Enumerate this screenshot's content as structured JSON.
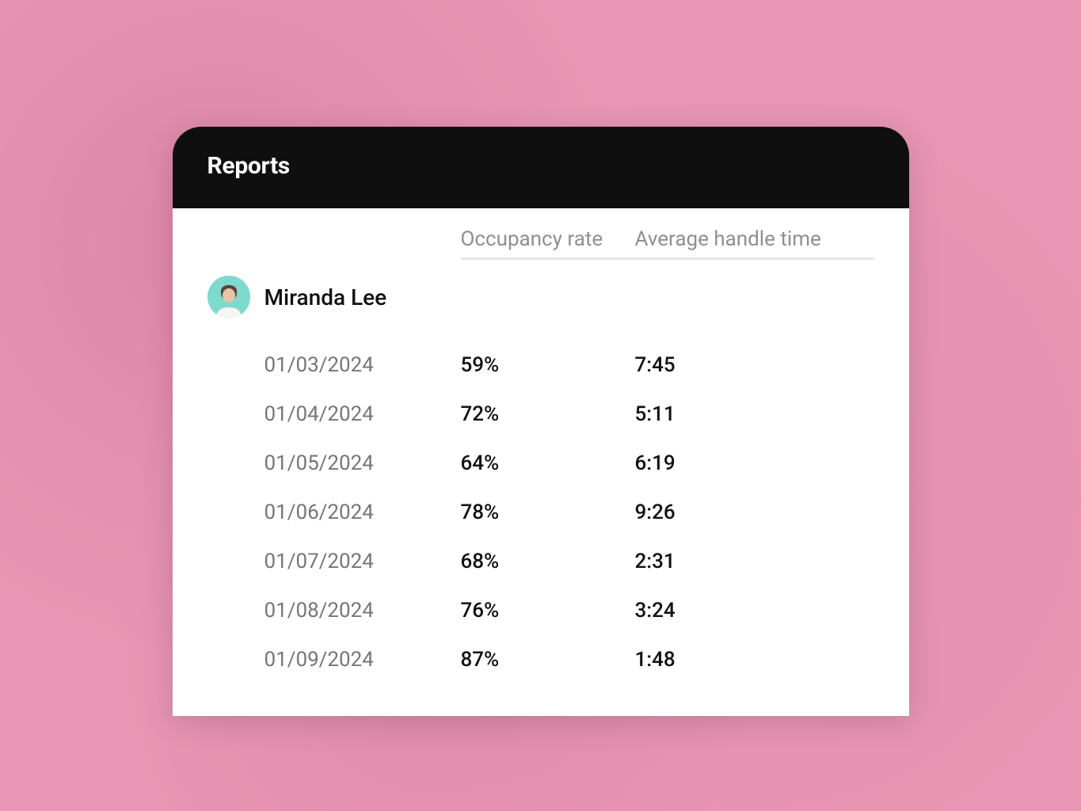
{
  "card": {
    "title": "Reports"
  },
  "columns": {
    "occupancy": "Occupancy rate",
    "handle_time": "Average handle time"
  },
  "agent": {
    "name": "Miranda Lee",
    "avatar_bg": "#7ed9cf"
  },
  "rows": [
    {
      "date": "01/03/2024",
      "occupancy": "59%",
      "handle_time": "7:45"
    },
    {
      "date": "01/04/2024",
      "occupancy": "72%",
      "handle_time": "5:11"
    },
    {
      "date": "01/05/2024",
      "occupancy": "64%",
      "handle_time": "6:19"
    },
    {
      "date": "01/06/2024",
      "occupancy": "78%",
      "handle_time": "9:26"
    },
    {
      "date": "01/07/2024",
      "occupancy": "68%",
      "handle_time": "2:31"
    },
    {
      "date": "01/08/2024",
      "occupancy": "76%",
      "handle_time": "3:24"
    },
    {
      "date": "01/09/2024",
      "occupancy": "87%",
      "handle_time": "1:48"
    }
  ]
}
